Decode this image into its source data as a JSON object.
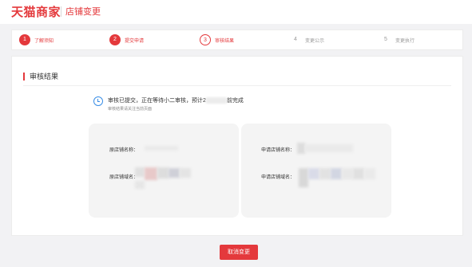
{
  "header": {
    "logo": "天猫商家",
    "title": "店铺变更"
  },
  "steps": [
    {
      "num": "1",
      "label": "了解须知",
      "state": "done"
    },
    {
      "num": "2",
      "label": "提交申请",
      "state": "done"
    },
    {
      "num": "3",
      "label": "审核结果",
      "state": "current"
    },
    {
      "num": "4",
      "label": "变更公示",
      "state": "todo"
    },
    {
      "num": "5",
      "label": "变更执行",
      "state": "todo"
    }
  ],
  "section": {
    "title": "审核结果"
  },
  "status": {
    "main_prefix": "审核已提交，正在等待小二审核，预计2",
    "main_suffix": "前完成",
    "sub": "审核结果请关注当前页面"
  },
  "left_panel": {
    "name_label": "原店铺名称：",
    "domain_label": "原店铺域名："
  },
  "right_panel": {
    "name_label": "申请店铺名称：",
    "domain_label": "申请店铺域名："
  },
  "actions": {
    "cancel_label": "取消变更"
  },
  "colors": {
    "brand": "#e4393c",
    "info": "#3a8ee6"
  }
}
